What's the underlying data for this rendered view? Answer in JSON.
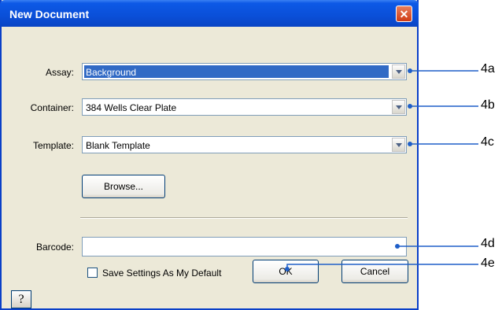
{
  "dialog": {
    "title": "New Document",
    "close_glyph": "✕",
    "assay": {
      "label": "Assay:",
      "value": "Background"
    },
    "container": {
      "label": "Container:",
      "value": "384 Wells Clear Plate"
    },
    "template": {
      "label": "Template:",
      "value": "Blank Template"
    },
    "browse_label": "Browse...",
    "barcode": {
      "label": "Barcode:",
      "value": ""
    },
    "save_default_label": "Save Settings As My Default",
    "ok_label": "OK",
    "cancel_label": "Cancel",
    "help_label": "?"
  },
  "callouts": [
    "4a",
    "4b",
    "4c",
    "4d",
    "4e"
  ],
  "colors": {
    "title_bar": "#0a4fd8",
    "selection": "#316ac5",
    "callout_line": "#1f5fc8"
  }
}
